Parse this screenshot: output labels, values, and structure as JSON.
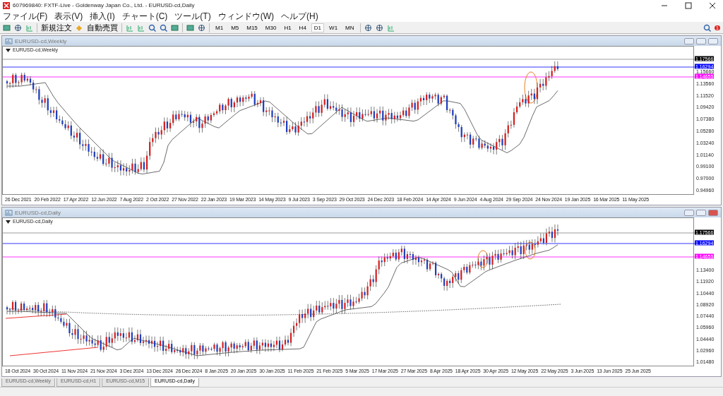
{
  "window": {
    "title": "607969840: FXTF-Live - Goldenway Japan Co., Ltd. - EURUSD-cd,Daily"
  },
  "menu": [
    "ファイル(F)",
    "表示(V)",
    "挿入(I)",
    "チャート(C)",
    "ツール(T)",
    "ウィンドウ(W)",
    "ヘルプ(H)"
  ],
  "toolbar": {
    "order_button": "新規注文",
    "autotrade_button": "自動売買",
    "timeframes": [
      {
        "label": "M1",
        "selected": false
      },
      {
        "label": "M5",
        "selected": false
      },
      {
        "label": "M15",
        "selected": false
      },
      {
        "label": "M30",
        "selected": false
      },
      {
        "label": "H1",
        "selected": false
      },
      {
        "label": "H4",
        "selected": false
      },
      {
        "label": "D1",
        "selected": true
      },
      {
        "label": "W1",
        "selected": false
      },
      {
        "label": "MN",
        "selected": false
      }
    ],
    "notification_badge": "1"
  },
  "charts": [
    {
      "title": "EURUSD-cd,Weekly",
      "label": "EURUSD-cd,Weekly",
      "active": false,
      "price_ticks": [
        "1.15660",
        "1.13560",
        "1.11520",
        "1.09420",
        "1.07380",
        "1.05280",
        "1.03240",
        "1.01140",
        "0.99100",
        "0.97000",
        "0.94960"
      ],
      "price_markers": [
        {
          "text": "1.17566",
          "color": "#000000"
        },
        {
          "text": "1.16294",
          "color": "#0000ff"
        },
        {
          "text": "1.14655",
          "color": "#ff00ff"
        }
      ],
      "dates": [
        "26 Dec 2021",
        "20 Feb 2022",
        "17 Apr 2022",
        "12 Jun 2022",
        "7 Aug 2022",
        "2 Oct 2022",
        "27 Nov 2022",
        "22 Jan 2023",
        "19 Mar 2023",
        "14 May 2023",
        "9 Jul 2023",
        "3 Sep 2023",
        "29 Oct 2023",
        "24 Dec 2023",
        "18 Feb 2024",
        "14 Apr 2024",
        "9 Jun 2024",
        "4 Aug 2024",
        "29 Sep 2024",
        "24 Nov 2024",
        "19 Jan 2025",
        "16 Mar 2025",
        "11 May 2025"
      ]
    },
    {
      "title": "EURUSD-cd,Daily",
      "label": "EURUSD-cd,Daily",
      "active": true,
      "price_ticks": [
        "1.13400",
        "1.11920",
        "1.10440",
        "1.08920",
        "1.07440",
        "1.05960",
        "1.04440",
        "1.02960",
        "1.01480"
      ],
      "price_markers": [
        {
          "text": "1.17566",
          "color": "#000000"
        },
        {
          "text": "1.16294",
          "color": "#0000ff"
        },
        {
          "text": "1.14655",
          "color": "#ff00ff"
        }
      ],
      "dates": [
        "18 Oct 2024",
        "30 Oct 2024",
        "11 Nov 2024",
        "21 Nov 2024",
        "3 Dec 2024",
        "13 Dec 2024",
        "26 Dec 2024",
        "8 Jan 2025",
        "20 Jan 2025",
        "30 Jan 2025",
        "11 Feb 2025",
        "21 Feb 2025",
        "5 Mar 2025",
        "17 Mar 2025",
        "27 Mar 2025",
        "8 Apr 2025",
        "18 Apr 2025",
        "30 Apr 2025",
        "12 May 2025",
        "22 May 2025",
        "3 Jun 2025",
        "13 Jun 2025",
        "25 Jun 2025"
      ]
    }
  ],
  "tabs": [
    {
      "label": "EURUSD-cd,Weekly",
      "selected": false
    },
    {
      "label": "EURUSD-cd,H1",
      "selected": false
    },
    {
      "label": "EURUSD-cd,M15",
      "selected": false
    },
    {
      "label": "EURUSD-cd,Daily",
      "selected": true
    }
  ]
}
